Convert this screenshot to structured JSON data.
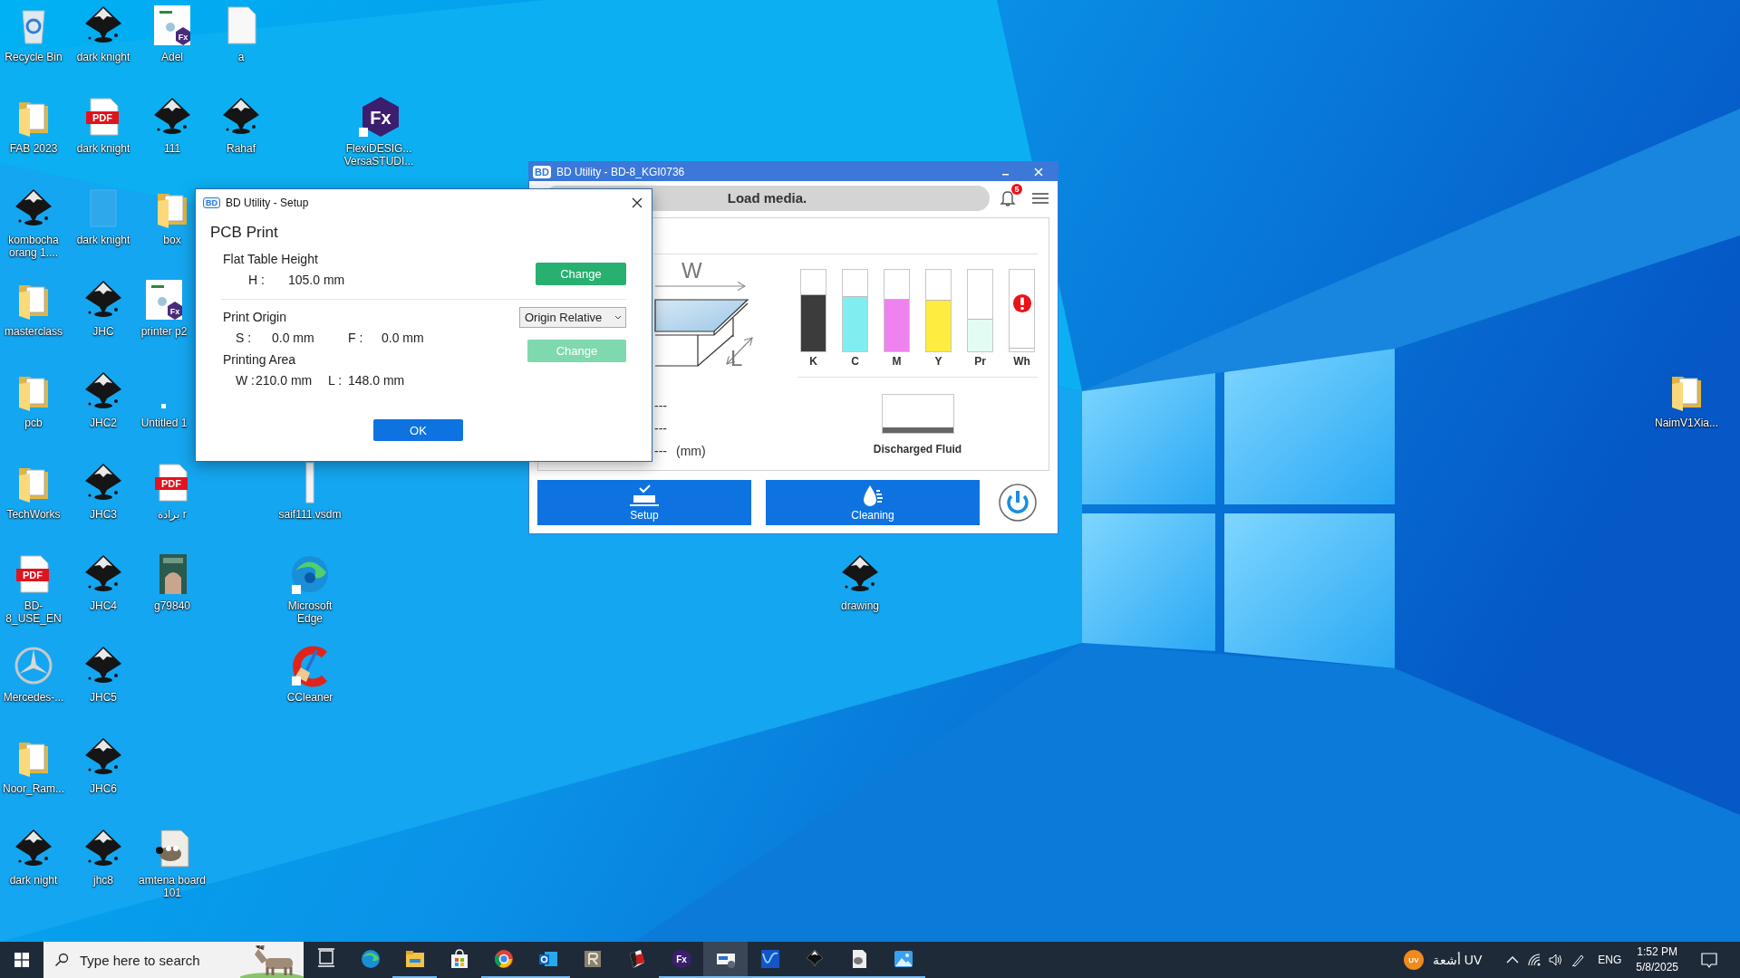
{
  "desktop_icons": [
    {
      "label": "Recycle Bin",
      "kind": "recycle"
    },
    {
      "label": "FAB 2023",
      "kind": "folder"
    },
    {
      "label": "kombocha orang 1....",
      "kind": "inkscape"
    },
    {
      "label": "masterclass",
      "kind": "folder"
    },
    {
      "label": "pcb",
      "kind": "folder"
    },
    {
      "label": "TechWorks",
      "kind": "folder"
    },
    {
      "label": "BD-8_USE_EN",
      "kind": "pdf",
      "badge": "PDF"
    },
    {
      "label": "Mercedes-...",
      "kind": "star"
    },
    {
      "label": "Noor_Ram...",
      "kind": "folder"
    },
    {
      "label": "dark night",
      "kind": "inkscape"
    },
    {
      "label": "dark knight",
      "kind": "inkscape"
    },
    {
      "label": "dark knight",
      "kind": "pdf",
      "badge": "PDF"
    },
    {
      "label": "dark knight",
      "kind": "faded"
    },
    {
      "label": "JHC",
      "kind": "inkscape"
    },
    {
      "label": "JHC2",
      "kind": "inkscape"
    },
    {
      "label": "JHC3",
      "kind": "inkscape"
    },
    {
      "label": "JHC4",
      "kind": "inkscape"
    },
    {
      "label": "JHC5",
      "kind": "inkscape"
    },
    {
      "label": "JHC6",
      "kind": "inkscape"
    },
    {
      "label": "jhc8",
      "kind": "inkscape"
    },
    {
      "label": "Adel",
      "kind": "docfx",
      "badge": "Fx"
    },
    {
      "label": "111",
      "kind": "inkscape"
    },
    {
      "label": "box",
      "kind": "folder"
    },
    {
      "label": "printer p2",
      "kind": "docfx",
      "badge": "Fx"
    },
    {
      "label": "Untitled 1",
      "kind": "dot"
    },
    {
      "label": "برادة r",
      "kind": "pdf",
      "badge": "PDF"
    },
    {
      "label": "g79840"
    },
    {
      "label": "amtena board 101",
      "kind": "gimp"
    },
    {
      "label": "a",
      "kind": "blank"
    },
    {
      "label": "Rahaf",
      "kind": "inkscape"
    },
    {
      "label": "saif111.vsdm",
      "kind": "vsdm"
    },
    {
      "label": "Microsoft Edge",
      "kind": "edge"
    },
    {
      "label": "CCleaner",
      "kind": "ccleaner"
    },
    {
      "label": "FlexiDESIG... VersaSTUDI...",
      "kind": "fxapp",
      "badge": "Fx"
    },
    {
      "label": "drawing",
      "kind": "inkscape"
    },
    {
      "label": "NaimV1Xia...",
      "kind": "folder"
    }
  ],
  "bd_window": {
    "app_icon": "BD",
    "title": "BD Utility - BD-8_KGI0736",
    "status": "Load media.",
    "notifications": "5",
    "diagram": {
      "width_label": "W",
      "length_label": "L",
      "readings": [
        "---",
        "---",
        "---"
      ],
      "unit": "(mm)"
    },
    "inks": [
      {
        "name": "K",
        "color": "#3c3c3c",
        "level": 0.7,
        "error": false
      },
      {
        "name": "C",
        "color": "#80eef0",
        "level": 0.68,
        "error": false
      },
      {
        "name": "M",
        "color": "#ee82ee",
        "level": 0.65,
        "error": false
      },
      {
        "name": "Y",
        "color": "#ffec40",
        "level": 0.63,
        "error": false
      },
      {
        "name": "Pr",
        "color": "#e2fcf4",
        "level": 0.4,
        "error": false
      },
      {
        "name": "Wh",
        "color": "#ffffff",
        "level": 0.05,
        "error": true
      }
    ],
    "discharged": {
      "label": "Discharged Fluid"
    },
    "buttons": [
      {
        "label": "Setup",
        "kind": "setup"
      },
      {
        "label": "Cleaning",
        "kind": "cleaning"
      }
    ]
  },
  "setup_dialog": {
    "app_icon": "BD",
    "title": "BD Utility - Setup",
    "heading": "PCB Print",
    "flat_table": {
      "label": "Flat Table Height",
      "key": "H :",
      "value": "105.0 mm",
      "button": {
        "label": "Change",
        "disabled": false
      }
    },
    "print_origin": {
      "label": "Print Origin",
      "dropdown": "Origin Relative",
      "s_key": "S :",
      "s_value": "0.0 mm",
      "f_key": "F :",
      "f_value": "0.0 mm",
      "button": {
        "label": "Change",
        "disabled": true
      }
    },
    "printing_area": {
      "label": "Printing Area",
      "w_key": "W :",
      "w_value": "210.0 mm",
      "l_key": "L :",
      "l_value": "148.0 mm"
    },
    "ok": "OK"
  },
  "taskbar": {
    "search_placeholder": "Type here to search",
    "apps": [
      {
        "kind": "taskview",
        "running": false,
        "selected": false
      },
      {
        "kind": "edge",
        "running": false,
        "selected": false
      },
      {
        "kind": "explorer",
        "running": true,
        "selected": false
      },
      {
        "kind": "store",
        "running": false,
        "selected": false
      },
      {
        "kind": "chrome",
        "running": true,
        "selected": false
      },
      {
        "kind": "outlook",
        "running": true,
        "selected": false
      },
      {
        "kind": "rapp",
        "running": false,
        "selected": false
      },
      {
        "kind": "redapp",
        "running": false,
        "selected": false
      },
      {
        "kind": "fx",
        "running": true,
        "selected": false,
        "badge": "Fx"
      },
      {
        "kind": "bd",
        "running": true,
        "selected": true
      },
      {
        "kind": "wave",
        "running": true,
        "selected": false
      },
      {
        "kind": "inkscape",
        "running": true,
        "selected": false
      },
      {
        "kind": "gimp",
        "running": true,
        "selected": false
      },
      {
        "kind": "photos",
        "running": true,
        "selected": false
      }
    ],
    "tray": {
      "badge": "UV",
      "label": "أشعة UV",
      "language": "ENG",
      "time": "1:52 PM",
      "date": "5/8/2025"
    }
  }
}
